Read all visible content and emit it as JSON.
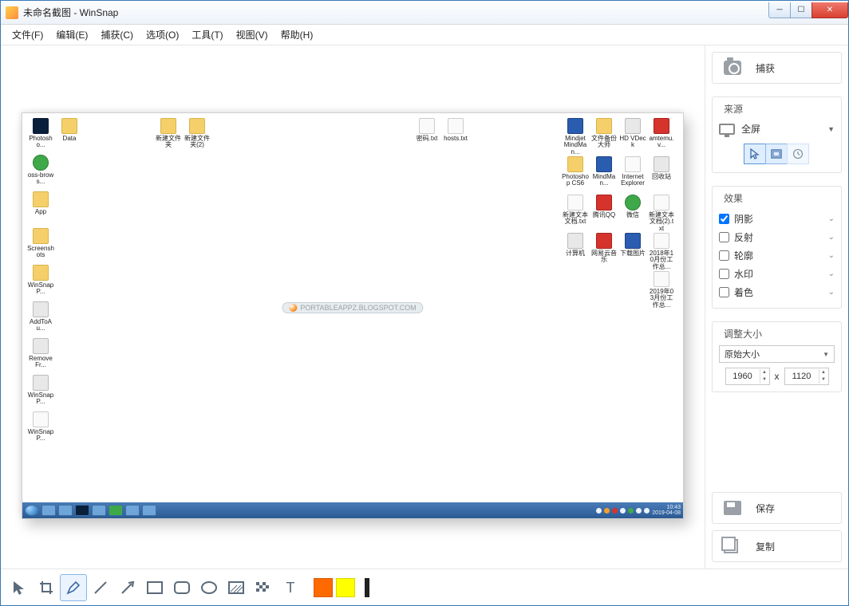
{
  "window": {
    "title": "未命名截图 - WinSnap"
  },
  "menu": {
    "file": "文件(F)",
    "edit": "编辑(E)",
    "capture": "捕获(C)",
    "options": "选项(O)",
    "tools": "工具(T)",
    "view": "视图(V)",
    "help": "帮助(H)"
  },
  "sidebar": {
    "capture_btn": "捕获",
    "source": {
      "legend": "来源",
      "mode": "全屏"
    },
    "effects": {
      "legend": "效果",
      "shadow": "阴影",
      "reflection": "反射",
      "outline": "轮廓",
      "watermark": "水印",
      "tint": "着色"
    },
    "resize": {
      "legend": "调整大小",
      "preset": "原始大小",
      "width": "1960",
      "height": "1120",
      "times": "x"
    },
    "save_btn": "保存",
    "copy_btn": "复制"
  },
  "screenshot": {
    "watermark": "PORTABLEAPPZ.BLOGSPOT.COM",
    "taskbar_time": "10:43",
    "taskbar_date": "2019-04-08",
    "icons_left": [
      {
        "label": "Photosho...",
        "cls": "ps"
      },
      {
        "label": "Data",
        "cls": ""
      },
      {
        "label": "oss-brows...",
        "cls": "grn"
      },
      {
        "label": "App",
        "cls": ""
      },
      {
        "label": "Screenshots",
        "cls": ""
      },
      {
        "label": "WinSnapP...",
        "cls": ""
      },
      {
        "label": "AddToAu...",
        "cls": "gray"
      },
      {
        "label": "RemoveFr...",
        "cls": "gray"
      },
      {
        "label": "WinSnapP...",
        "cls": "gray"
      },
      {
        "label": "WinSnapP...",
        "cls": "wht"
      }
    ],
    "icons_mid": [
      {
        "label": "新建文件夹",
        "cls": ""
      },
      {
        "label": "新建文件夹(2)",
        "cls": ""
      }
    ],
    "icons_mid2": [
      {
        "label": "密码.txt",
        "cls": "wht"
      },
      {
        "label": "hosts.txt",
        "cls": "wht"
      }
    ],
    "icons_right": [
      [
        {
          "label": "Mindjet MindMan...",
          "cls": "blue"
        },
        {
          "label": "文件备份大师",
          "cls": ""
        },
        {
          "label": "HD VDeck",
          "cls": "gray"
        },
        {
          "label": "amtemu.v...",
          "cls": "red"
        }
      ],
      [
        {
          "label": "Photoshop CS6",
          "cls": ""
        },
        {
          "label": "MindMan...",
          "cls": "blue"
        },
        {
          "label": "Internet Explorer",
          "cls": "wht"
        },
        {
          "label": "回收站",
          "cls": "gray"
        }
      ],
      [
        {
          "label": "新建文本文档.txt",
          "cls": "wht"
        },
        {
          "label": "腾讯QQ",
          "cls": "red"
        },
        {
          "label": "微信",
          "cls": "grn"
        },
        {
          "label": "新建文本文档(2).txt",
          "cls": "wht"
        }
      ],
      [
        {
          "label": "计算机",
          "cls": "gray"
        },
        {
          "label": "网易云音乐",
          "cls": "red"
        },
        {
          "label": "下载图片",
          "cls": "blue"
        },
        {
          "label": "2018年10月份工作总...",
          "cls": "wht"
        }
      ],
      [
        {
          "label": "",
          "cls": "none"
        },
        {
          "label": "",
          "cls": "none"
        },
        {
          "label": "",
          "cls": "none"
        },
        {
          "label": "2019年03月份工作总...",
          "cls": "wht"
        }
      ]
    ]
  },
  "colors": {
    "swatch1": "#ff6a00",
    "swatch2": "#ffff00",
    "swatch3": "#222222"
  }
}
